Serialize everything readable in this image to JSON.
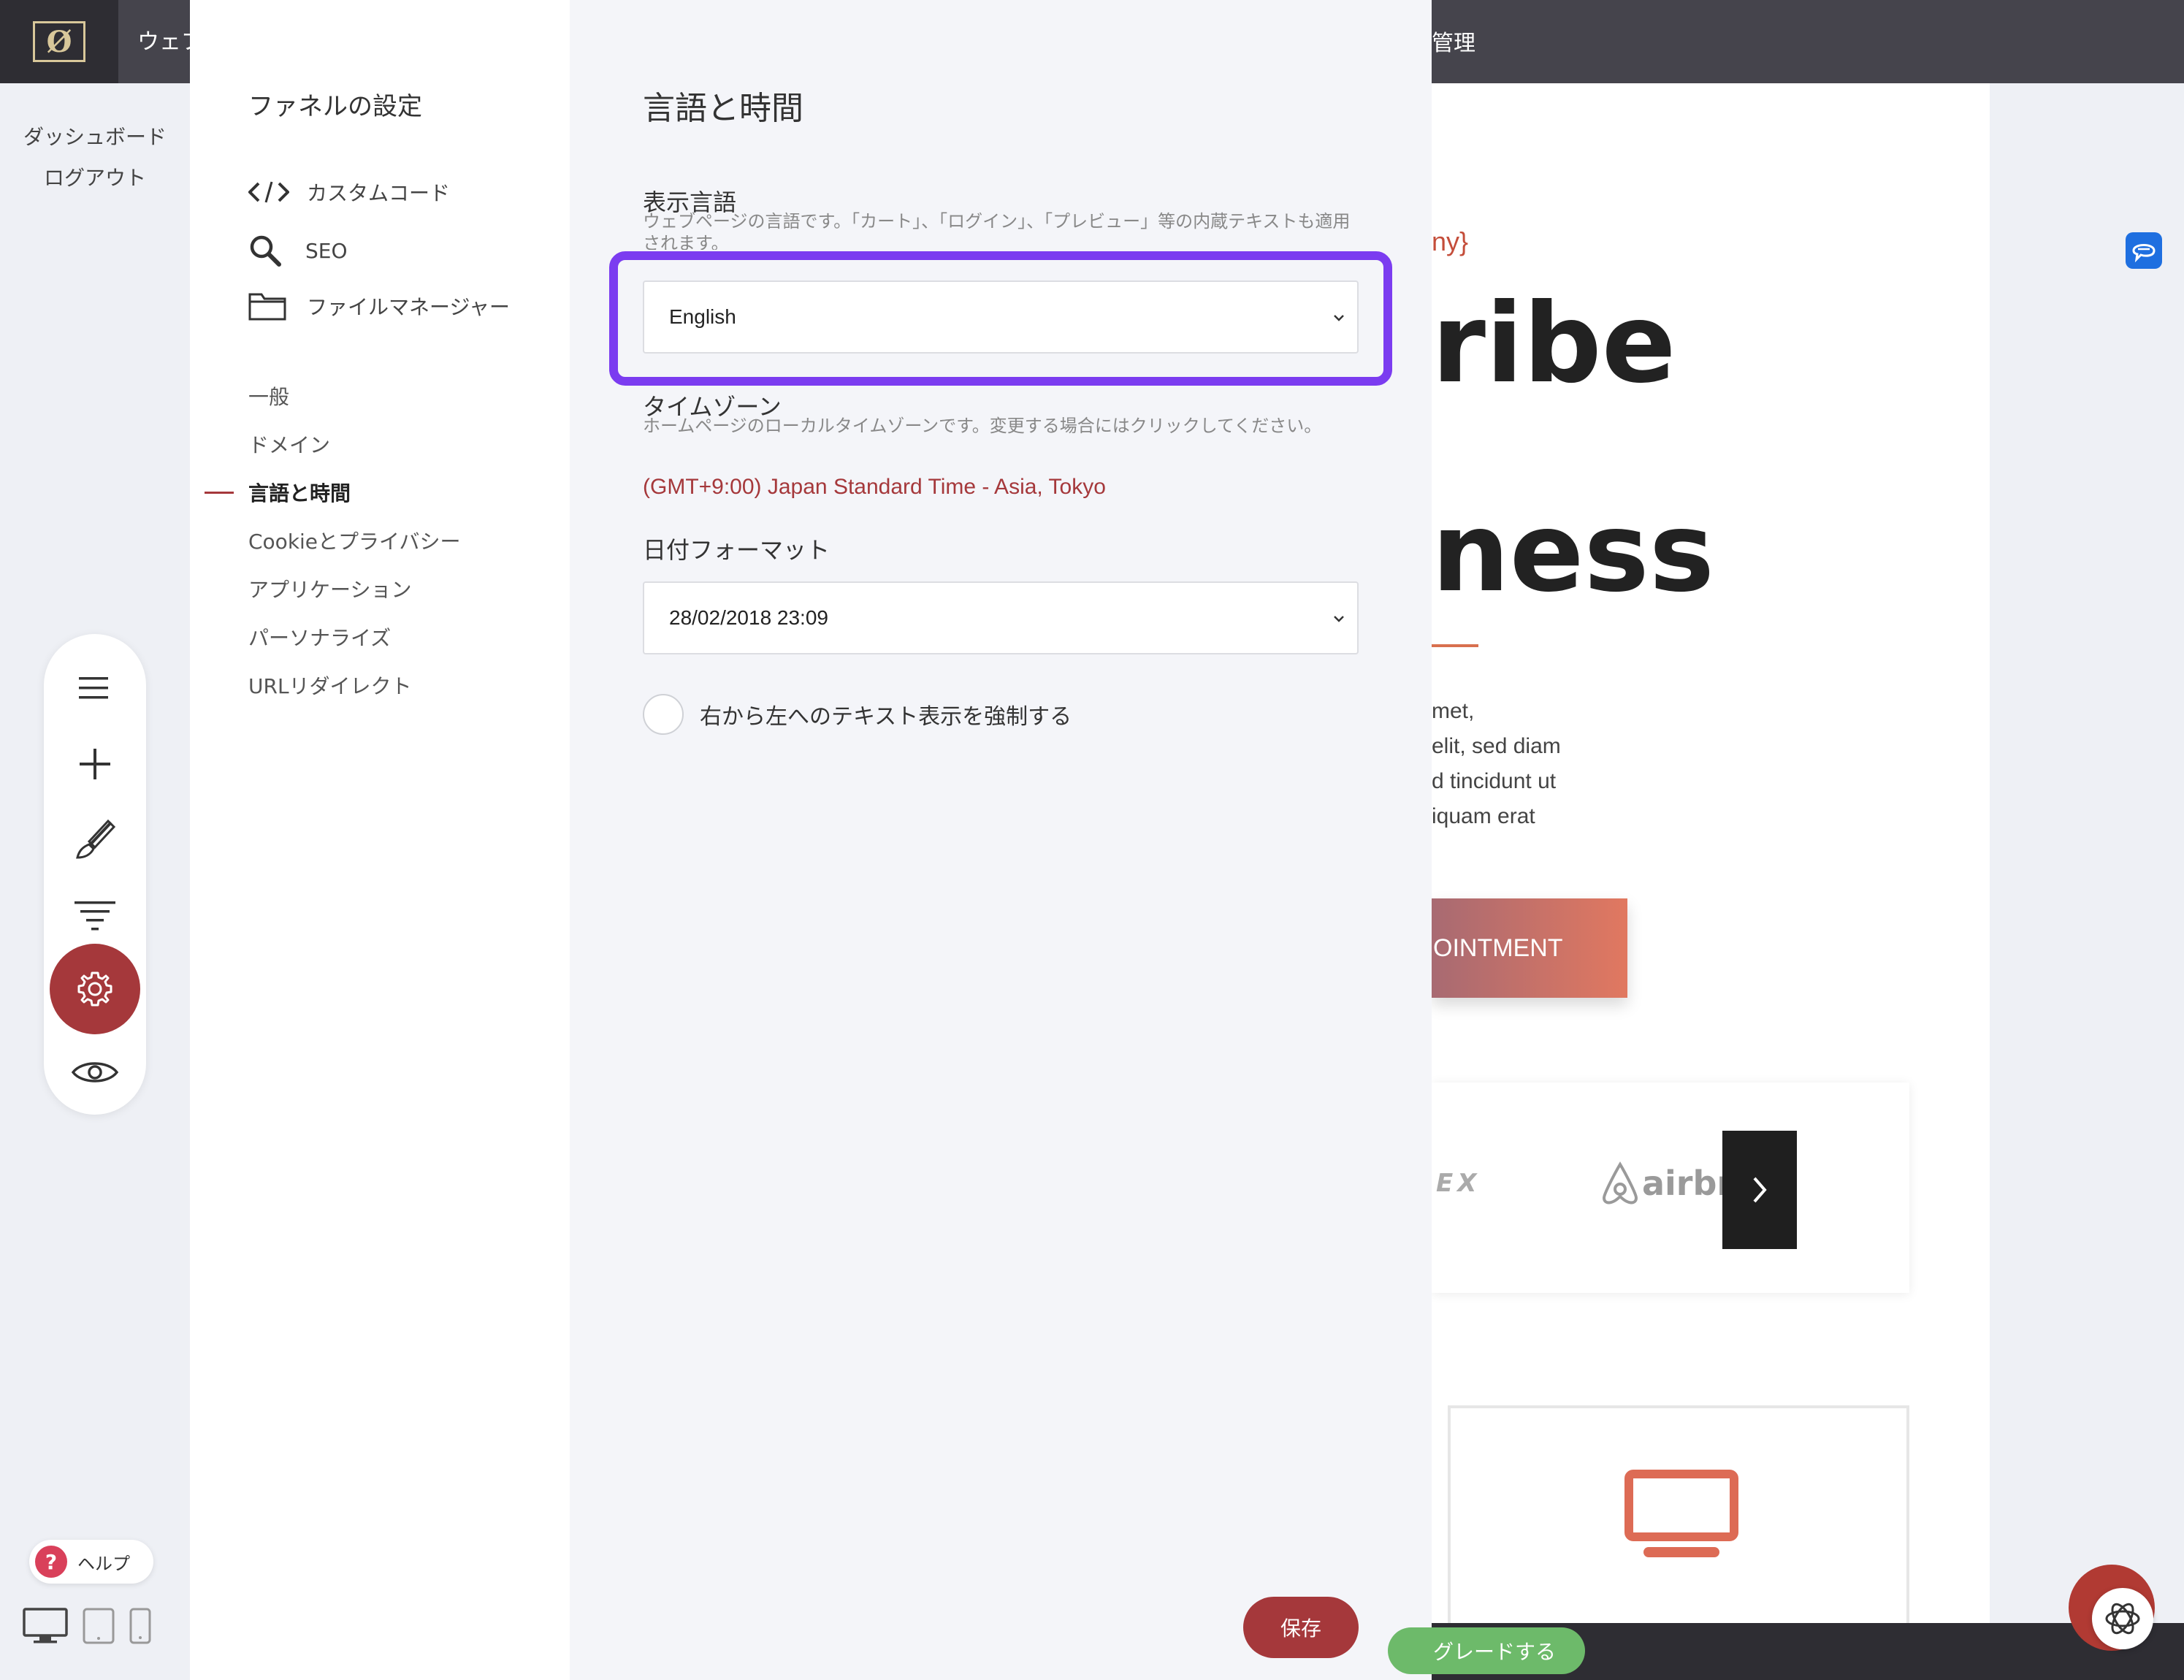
{
  "topbar": {
    "logo_text": "Ø",
    "left_text": "ウェブ",
    "right_text": "管理"
  },
  "left_sidebar": {
    "dashboard": "ダッシュボード",
    "logout": "ログアウト",
    "toolbar_icons": [
      "menu-icon",
      "plus-icon",
      "brush-icon",
      "funnel-filter-icon",
      "gear-icon",
      "eye-icon"
    ],
    "help_label": "ヘルプ",
    "help_mark": "?",
    "device_icons": [
      "desktop-icon",
      "tablet-icon",
      "mobile-icon"
    ]
  },
  "nav": {
    "title": "ファネルの設定",
    "tools": [
      {
        "label": "カスタムコード",
        "icon": "code-icon"
      },
      {
        "label": "SEO",
        "icon": "search-icon"
      },
      {
        "label": "ファイルマネージャー",
        "icon": "folder-icon"
      }
    ],
    "items": [
      {
        "label": "一般"
      },
      {
        "label": "ドメイン"
      },
      {
        "label": "言語と時間",
        "active": true
      },
      {
        "label": "Cookieとプライバシー"
      },
      {
        "label": "アプリケーション"
      },
      {
        "label": "パーソナライズ"
      },
      {
        "label": "URLリダイレクト"
      }
    ]
  },
  "content": {
    "title": "言語と時間",
    "language": {
      "label": "表示言語",
      "description": "ウェブページの言語です。「カート」、「ログイン」、「プレビュー」等の内蔵テキストも適用されます。",
      "value": "English"
    },
    "timezone": {
      "label": "タイムゾーン",
      "description": "ホームページのローカルタイムゾーンです。変更する場合にはクリックしてください。",
      "value": "(GMT+9:00) Japan Standard Time - Asia, Tokyo"
    },
    "date_format": {
      "label": "日付フォーマット",
      "value": "28/02/2018 23:09"
    },
    "rtl_label": "右から左へのテキスト表示を強制する",
    "save_label": "保存"
  },
  "preview": {
    "company": "ny}",
    "heading_line1": "ribe",
    "heading_line2": "ness",
    "paragraph": [
      "met,",
      "elit, sed diam",
      "d tincidunt ut",
      "iquam erat"
    ],
    "cta": "OINTMENT",
    "logo1": "EX",
    "logo2": "airbn",
    "upgrade_label": "グレードする"
  },
  "colors": {
    "accent": "#a5383b",
    "highlight": "#7b3cf0",
    "topbar": "#45444c",
    "upgrade": "#6dba6a"
  }
}
